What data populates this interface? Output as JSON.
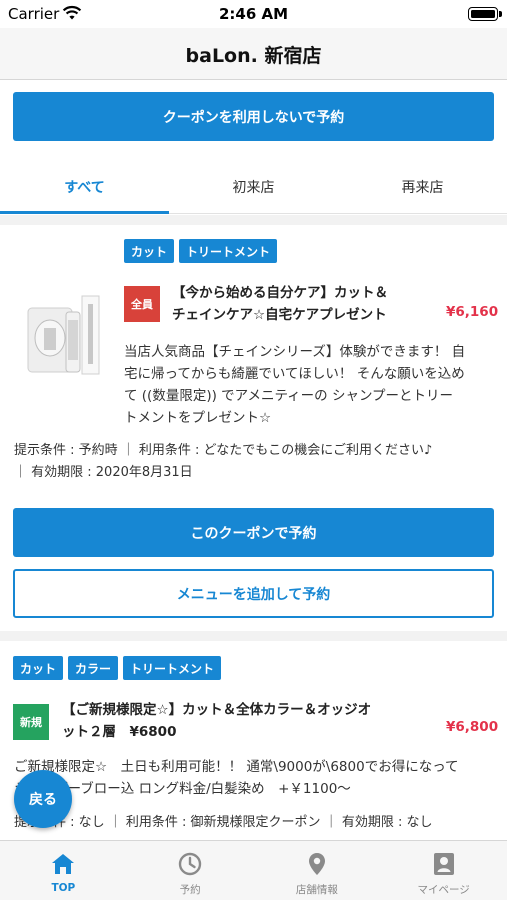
{
  "status": {
    "carrier": "Carrier",
    "time": "2:46 AM"
  },
  "nav": {
    "title": "baLon. 新宿店"
  },
  "reserve_no_coupon": "クーポンを利用しないで予約",
  "tabs": [
    {
      "label": "すべて",
      "active": true
    },
    {
      "label": "初来店",
      "active": false
    },
    {
      "label": "再来店",
      "active": false
    }
  ],
  "coupons": [
    {
      "tags": [
        "カット",
        "トリートメント"
      ],
      "badge": "全員",
      "title_line1": "【今から始める自分ケア】カット＆",
      "title_line2": "チェインケア☆自宅ケアプレゼント",
      "price": "¥6,160",
      "desc_lines": [
        "当店人気商品【チェインシリーズ】体験ができます！ 自",
        "宅に帰ってからも綺麗でいてほしい！ そんな願いを込め",
        "て ((数量限定)) でアメニティーの シャンプーとトリー",
        "トメントをプレゼント☆"
      ],
      "cond_lines": [
        "提示条件 : 予約時 ｜ 利用条件 : どなたでもこの機会にご利用ください♪",
        "｜ 有効期限 : 2020年8月31日"
      ],
      "book_button": "このクーポンで予約",
      "add_menu_button": "メニューを追加して予約"
    },
    {
      "tags": [
        "カット",
        "カラー",
        "トリートメント"
      ],
      "badge": "新規",
      "title_line1": "【ご新規様限定☆】カット＆全体カラー＆オッジオ",
      "title_line2": "ット２層　¥6800",
      "price": "¥6,800",
      "desc_lines": [
        "ご新規様限定☆　土日も利用可能！！ 通常\\9000が\\6800でお得になって",
        "シャンプーブロー込 ロング料金/白髪染め　+￥1100〜"
      ],
      "cond_lines": [
        "提示条件 : なし ｜ 利用条件 : 御新規様限定クーポン ｜ 有効期限 : なし"
      ]
    }
  ],
  "fab": {
    "label": "戻る"
  },
  "tabbar": [
    {
      "label": "TOP",
      "icon": "home-icon",
      "active": true
    },
    {
      "label": "予約",
      "icon": "clock-icon",
      "active": false
    },
    {
      "label": "店舗情報",
      "icon": "location-pin-icon",
      "active": false
    },
    {
      "label": "マイページ",
      "icon": "user-card-icon",
      "active": false
    }
  ],
  "colors": {
    "accent": "#1787d3",
    "price": "#e3324a",
    "badge_all": "#d8423a",
    "badge_new": "#25a35f"
  }
}
